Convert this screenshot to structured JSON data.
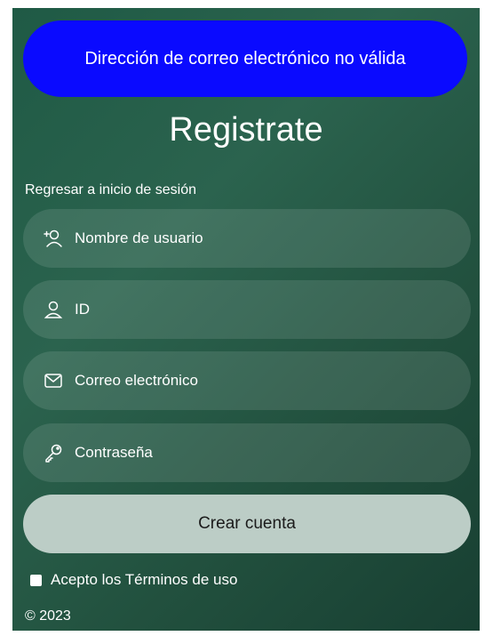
{
  "alert": {
    "message": "Dirección de correo electrónico no válida",
    "color": "#0a0aff"
  },
  "form": {
    "title": "Registrate",
    "back_link": "Regresar a inicio de sesión",
    "fields": [
      {
        "icon": "add-user-icon",
        "placeholder": "Nombre de usuario",
        "value": ""
      },
      {
        "icon": "user-icon",
        "placeholder": "ID",
        "value": ""
      },
      {
        "icon": "mail-icon",
        "placeholder": "Correo electrónico",
        "value": ""
      },
      {
        "icon": "key-icon",
        "placeholder": "Contraseña",
        "value": ""
      }
    ],
    "submit_label": "Crear cuenta",
    "terms_label": "Acepto los Términos de uso",
    "terms_checked": false
  },
  "footer": {
    "copyright": "© 2023"
  },
  "colors": {
    "background": "#245a46",
    "field_background": "rgba(255,255,255,0.11)",
    "button_background": "#bccdc6"
  }
}
